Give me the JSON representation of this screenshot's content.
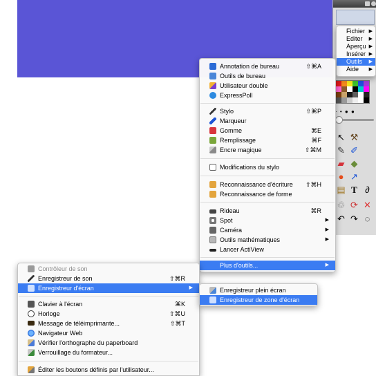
{
  "colors": {
    "background": "#5a55d6",
    "selection": "#3b7cf2"
  },
  "main_menu": {
    "items": [
      {
        "label": "Fichier"
      },
      {
        "label": "Editer"
      },
      {
        "label": "Aperçu"
      },
      {
        "label": "Insérer"
      },
      {
        "label": "Outils",
        "selected": true
      },
      {
        "label": "Aide"
      }
    ]
  },
  "tools_menu": {
    "items": [
      {
        "label": "Annotation de bureau",
        "shortcut": "⇧⌘A",
        "icon": "annotation-icon"
      },
      {
        "label": "Outils de bureau",
        "shortcut": "",
        "icon": "desktop-tools-icon"
      },
      {
        "label": "Utilisateur double",
        "shortcut": "",
        "icon": "dual-user-icon"
      },
      {
        "label": "ExpressPoll",
        "shortcut": "",
        "icon": "expresspoll-icon"
      },
      {
        "label": "Stylo",
        "shortcut": "⇧⌘P",
        "icon": "pen-icon"
      },
      {
        "label": "Marqueur",
        "shortcut": "",
        "icon": "highlighter-icon"
      },
      {
        "label": "Gomme",
        "shortcut": "⌘E",
        "icon": "eraser-icon"
      },
      {
        "label": "Remplissage",
        "shortcut": "⌘F",
        "icon": "fill-icon"
      },
      {
        "label": "Encre magique",
        "shortcut": "⇧⌘M",
        "icon": "magic-ink-icon"
      },
      {
        "label": "Modifications du stylo",
        "shortcut": "",
        "icon": "pen-modifier-icon"
      },
      {
        "label": "Reconnaissance d'écriture",
        "shortcut": "⇧⌘H",
        "icon": "handwriting-icon"
      },
      {
        "label": "Reconnaissance de forme",
        "shortcut": "",
        "icon": "shape-recognition-icon"
      },
      {
        "label": "Rideau",
        "shortcut": "⌘R",
        "icon": "curtain-icon"
      },
      {
        "label": "Spot",
        "shortcut": "",
        "icon": "spotlight-icon"
      },
      {
        "label": "Caméra",
        "shortcut": "",
        "icon": "camera-icon"
      },
      {
        "label": "Outils mathématiques",
        "shortcut": "",
        "icon": "math-tools-icon"
      },
      {
        "label": "Lancer ActiView",
        "shortcut": "",
        "icon": "actiview-icon"
      },
      {
        "label": "Plus d'outils...",
        "shortcut": "",
        "icon": ""
      }
    ]
  },
  "more_tools_menu": {
    "items": [
      {
        "label": "Contrôleur de son",
        "shortcut": "",
        "icon": "sound-controller-icon"
      },
      {
        "label": "Enregistreur de son",
        "shortcut": "⇧⌘R",
        "icon": "sound-recorder-icon"
      },
      {
        "label": "Enregistreur d'écran",
        "shortcut": "",
        "icon": "screen-recorder-icon"
      },
      {
        "label": "Clavier à l'écran",
        "shortcut": "⌘K",
        "icon": "keyboard-icon"
      },
      {
        "label": "Horloge",
        "shortcut": "⇧⌘U",
        "icon": "clock-icon"
      },
      {
        "label": "Message de téléimprimante...",
        "shortcut": "⇧⌘T",
        "icon": "ticker-icon"
      },
      {
        "label": "Navigateur Web",
        "shortcut": "",
        "icon": "web-browser-icon"
      },
      {
        "label": "Vérifier l'orthographe du paperboard",
        "shortcut": "",
        "icon": "spellcheck-icon"
      },
      {
        "label": "Verrouillage du formateur...",
        "shortcut": "",
        "icon": "lock-icon"
      },
      {
        "label": "Éditer les boutons définis par l'utilisateur...",
        "shortcut": "",
        "icon": "edit-buttons-icon"
      }
    ]
  },
  "screen_recorder_menu": {
    "items": [
      {
        "label": "Enregistreur plein écran",
        "icon": "fullscreen-recorder-icon"
      },
      {
        "label": "Enregistreur de zone d'écran",
        "icon": "area-recorder-icon"
      }
    ]
  }
}
